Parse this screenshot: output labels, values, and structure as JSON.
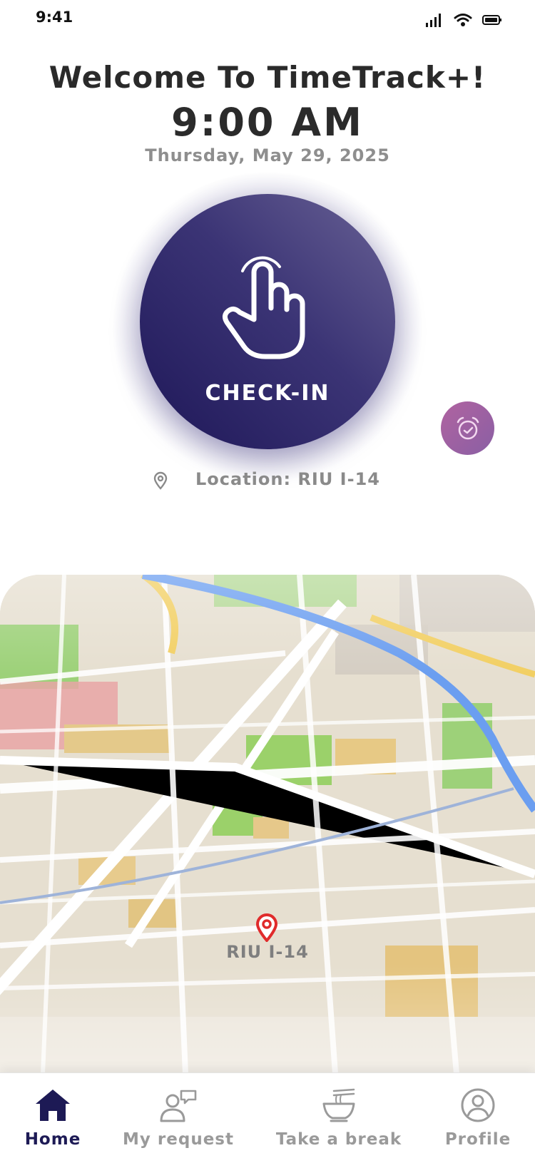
{
  "status_bar": {
    "time": "9:41"
  },
  "header": {
    "welcome": "Welcome To TimeTrack+!",
    "time": "9:00 AM",
    "date": "Thursday, May 29, 2025"
  },
  "checkin": {
    "label": "CHECK-IN"
  },
  "location": {
    "text": "Location: RIU I-14"
  },
  "map": {
    "pin_label": "RIU I-14"
  },
  "nav": {
    "items": [
      {
        "label": "Home",
        "icon": "home-icon",
        "active": true
      },
      {
        "label": "My request",
        "icon": "request-icon",
        "active": false
      },
      {
        "label": "Take a break",
        "icon": "noodle-bowl-icon",
        "active": false
      },
      {
        "label": "Profile",
        "icon": "profile-icon",
        "active": false
      }
    ]
  },
  "colors": {
    "primary": "#1d1a55",
    "button_gradient_light": "#6a6396",
    "button_gradient_dark": "#1e1758",
    "alarm_button": "#a061a2",
    "pin": "#e02b2b",
    "muted_text": "#8e8e8e"
  }
}
